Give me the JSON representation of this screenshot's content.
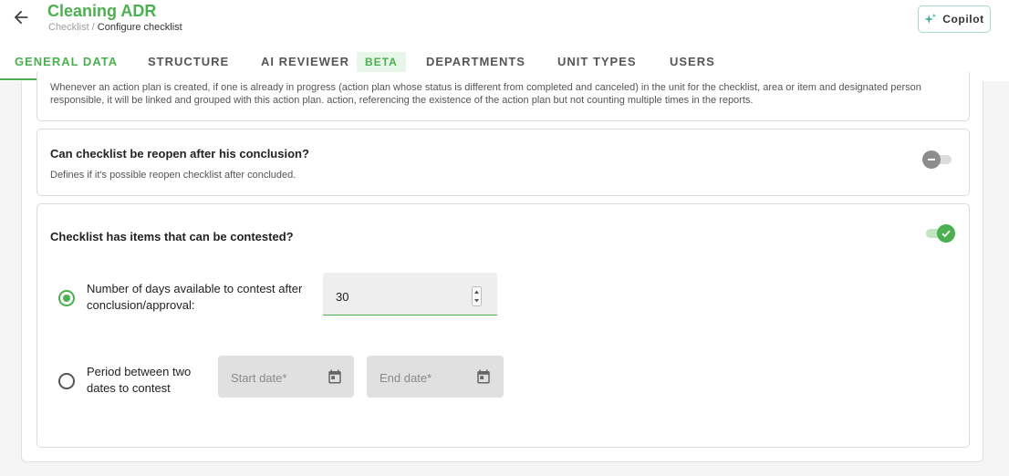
{
  "header": {
    "title": "Cleaning ADR",
    "breadcrumb_parent": "Checklist",
    "breadcrumb_separator": " / ",
    "breadcrumb_current": "Configure checklist",
    "copilot_label": "Copilot"
  },
  "tabs": [
    {
      "label": "GENERAL DATA",
      "active": true
    },
    {
      "label": "STRUCTURE",
      "active": false
    },
    {
      "label": "AI REVIEWER",
      "badge": "BETA",
      "active": false
    },
    {
      "label": "DEPARTMENTS",
      "active": false
    },
    {
      "label": "UNIT TYPES",
      "active": false
    },
    {
      "label": "USERS",
      "active": false
    }
  ],
  "action_plan_card": {
    "description": "Whenever an action plan is created, if one is already in progress (action plan whose status is different from completed and canceled) in the unit for the checklist, area or item and designated person responsible, it will be linked and grouped with this action plan. action, referencing the existence of the action plan but not counting multiple times in the reports."
  },
  "reopen_card": {
    "title": "Can checklist be reopen after his conclusion?",
    "description": "Defines if it's possible reopen checklist after concluded.",
    "enabled": false
  },
  "contest_card": {
    "title": "Checklist has items that can be contested?",
    "enabled": true,
    "days_option": {
      "label": "Number of days available to contest after conclusion/approval:",
      "selected": true,
      "value": "30"
    },
    "period_option": {
      "label": "Period between two dates to contest",
      "selected": false,
      "start_placeholder": "Start date*",
      "end_placeholder": "End date*"
    }
  },
  "colors": {
    "accent": "#4caf50",
    "copilot_border": "#a7d8d0",
    "toggle_off": "#8c8c8c"
  },
  "icons": [
    "arrow-left-icon",
    "sparkle-icon",
    "check-icon",
    "minus-icon",
    "spinner-up-icon",
    "spinner-down-icon",
    "calendar-icon"
  ]
}
